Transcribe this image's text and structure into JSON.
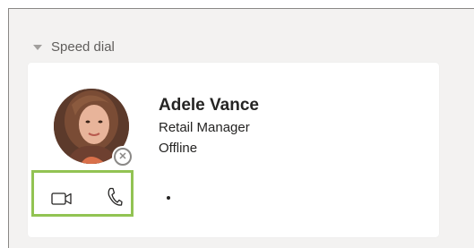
{
  "section": {
    "title": "Speed dial"
  },
  "contact": {
    "name": "Adele Vance",
    "role": "Retail Manager",
    "status": "Offline",
    "presence": "offline"
  },
  "actions": {
    "video_icon": "video-icon",
    "call_icon": "phone-icon",
    "more_icon": "more-options-icon"
  },
  "colors": {
    "highlight": "#92c353",
    "background": "#f3f2f1",
    "card": "#ffffff"
  }
}
